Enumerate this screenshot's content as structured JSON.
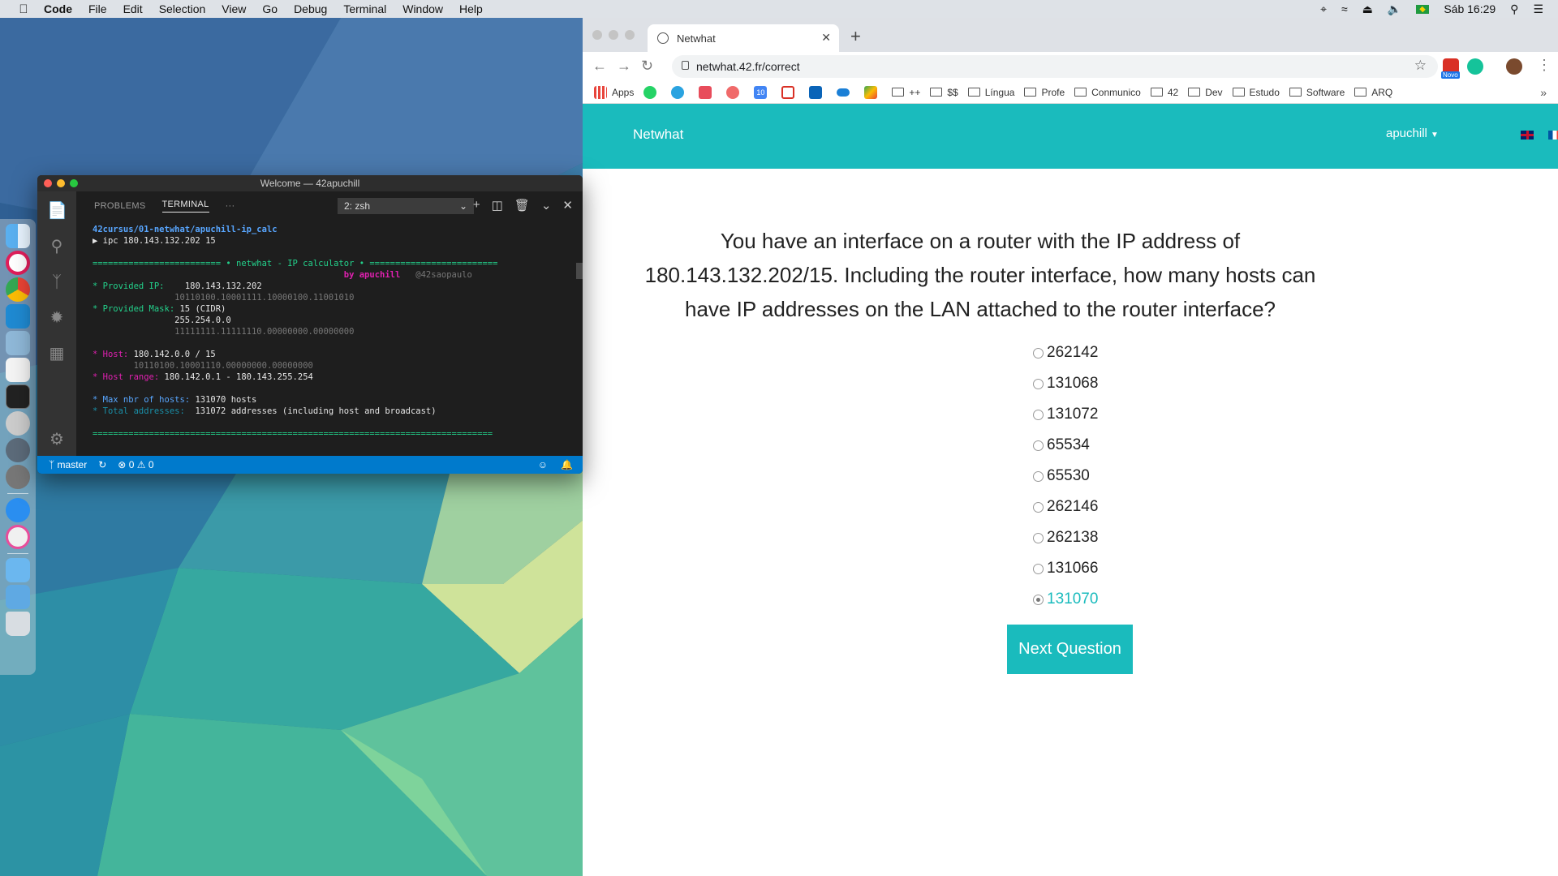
{
  "menubar": {
    "app_name": "Code",
    "items": [
      "File",
      "Edit",
      "Selection",
      "View",
      "Go",
      "Debug",
      "Terminal",
      "Window",
      "Help"
    ],
    "clock": "Sáb 16:29"
  },
  "vscode": {
    "title": "Welcome — 42apuchill",
    "tabs": {
      "problems": "PROBLEMS",
      "terminal": "TERMINAL",
      "more": "···"
    },
    "terminal_select": "2: zsh",
    "terminal_lines": {
      "path": "42cursus/01-netwhat/apuchill-ip_calc",
      "command": "▶ ipc 180.143.132.202 15",
      "banner": "========================= • netwhat - IP calculator • =========================",
      "by": "by apuchill",
      "handle": "@42saopaulo",
      "provided_ip_label": "* Provided IP:",
      "provided_ip": "180.143.132.202",
      "provided_ip_bin": "10110100.10001111.10000100.11001010",
      "mask_label": "* Provided Mask:",
      "mask_cidr": "15 (CIDR)",
      "mask_dec": "255.254.0.0",
      "mask_bin": "11111111.11111110.00000000.00000000",
      "host_label": "* Host:",
      "host": "180.142.0.0 / 15",
      "host_bin": "10110100.10001110.00000000.00000000",
      "host_range_label": "* Host range:",
      "host_range": "180.142.0.1 - 180.143.255.254",
      "max_hosts_label": "* Max nbr of hosts:",
      "max_hosts": "131070 hosts",
      "total_label": "* Total addresses:",
      "total": "131072 addresses (including host and broadcast)",
      "footer": "=============================================================================="
    },
    "status": {
      "branch": "master",
      "errors": "0",
      "warnings": "0"
    }
  },
  "chrome": {
    "tab_title": "Netwhat",
    "url": "netwhat.42.fr/correct",
    "ext_badge": "Novo",
    "bookmarks": {
      "apps": "Apps",
      "folders": [
        "++",
        "$$",
        "Língua",
        "Profe",
        "Conmunico",
        "42",
        "Dev",
        "Estudo",
        "Software",
        "ARQ"
      ],
      "ico10": "10"
    }
  },
  "netwhat": {
    "brand": "Netwhat",
    "user": "apuchill",
    "question": "You have an interface on a router with the IP address of 180.143.132.202/15. Including the router interface, how many hosts can have IP addresses on the LAN attached to the router interface?",
    "answers": [
      "262142",
      "131068",
      "131072",
      "65534",
      "65530",
      "262146",
      "262138",
      "131066",
      "131070"
    ],
    "selected_index": 8,
    "next_label": "Next Question",
    "accent": "#1abbbd"
  }
}
